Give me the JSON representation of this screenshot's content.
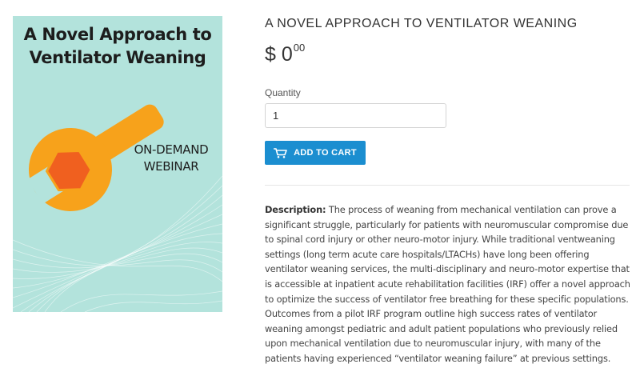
{
  "product_image": {
    "title_lines": [
      "A Novel Approach to",
      "Ventilator Weaning"
    ],
    "subtitle_lines": [
      "ON-DEMAND",
      "WEBINAR"
    ],
    "colors": {
      "background": "#b3e3dc",
      "wrench": "#f7a21b",
      "hexagon": "#f0601f",
      "text": "#1d1d1d"
    },
    "icon": "wrench-icon"
  },
  "product": {
    "title": "A NOVEL APPROACH TO VENTILATOR WEANING",
    "price_main": "$ 0",
    "price_cents": "00",
    "quantity_label": "Quantity",
    "quantity_value": "1",
    "add_to_cart_label": "ADD TO CART",
    "button_color": "#1b8ed0",
    "cart_icon": "shopping-cart-icon"
  },
  "description": {
    "label": "Description:",
    "text": " The process of weaning from mechanical ventilation can prove a significant struggle, particularly for patients with neuromuscular compromise due to spinal cord injury or other neuro-motor injury. While traditional ventweaning settings (long term acute care hospitals/LTACHs) have long been offering ventilator weaning services, the multi-disciplinary and neuro-motor expertise that is accessible at inpatient acute rehabilitation facilities (IRF) offer a novel approach to optimize the success of ventilator free breathing for these specific populations. Outcomes from a pilot IRF program outline high success rates of ventilator weaning amongst pediatric and adult patient populations who previously relied upon mechanical ventilation due to neuromuscular injury, with many of the patients having experienced “ventilator weaning failure” at previous settings."
  }
}
